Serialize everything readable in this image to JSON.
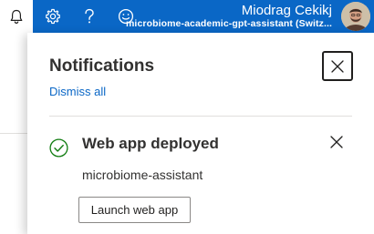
{
  "topbar": {
    "icons": [
      "bell-icon",
      "gear-icon",
      "help-icon",
      "feedback-icon"
    ],
    "user_name": "Miodrag Cekikj",
    "directory": "microbiome-academic-gpt-assistant (Switz..."
  },
  "panel": {
    "title": "Notifications",
    "dismiss_all": "Dismiss all",
    "notification": {
      "status_icon": "success-check-icon",
      "title": "Web app deployed",
      "resource": "microbiome-assistant",
      "action_label": "Launch web app"
    }
  },
  "colors": {
    "topbar": "#0a67c6",
    "link": "#0a67c6",
    "success": "#107c10",
    "text": "#323130"
  }
}
